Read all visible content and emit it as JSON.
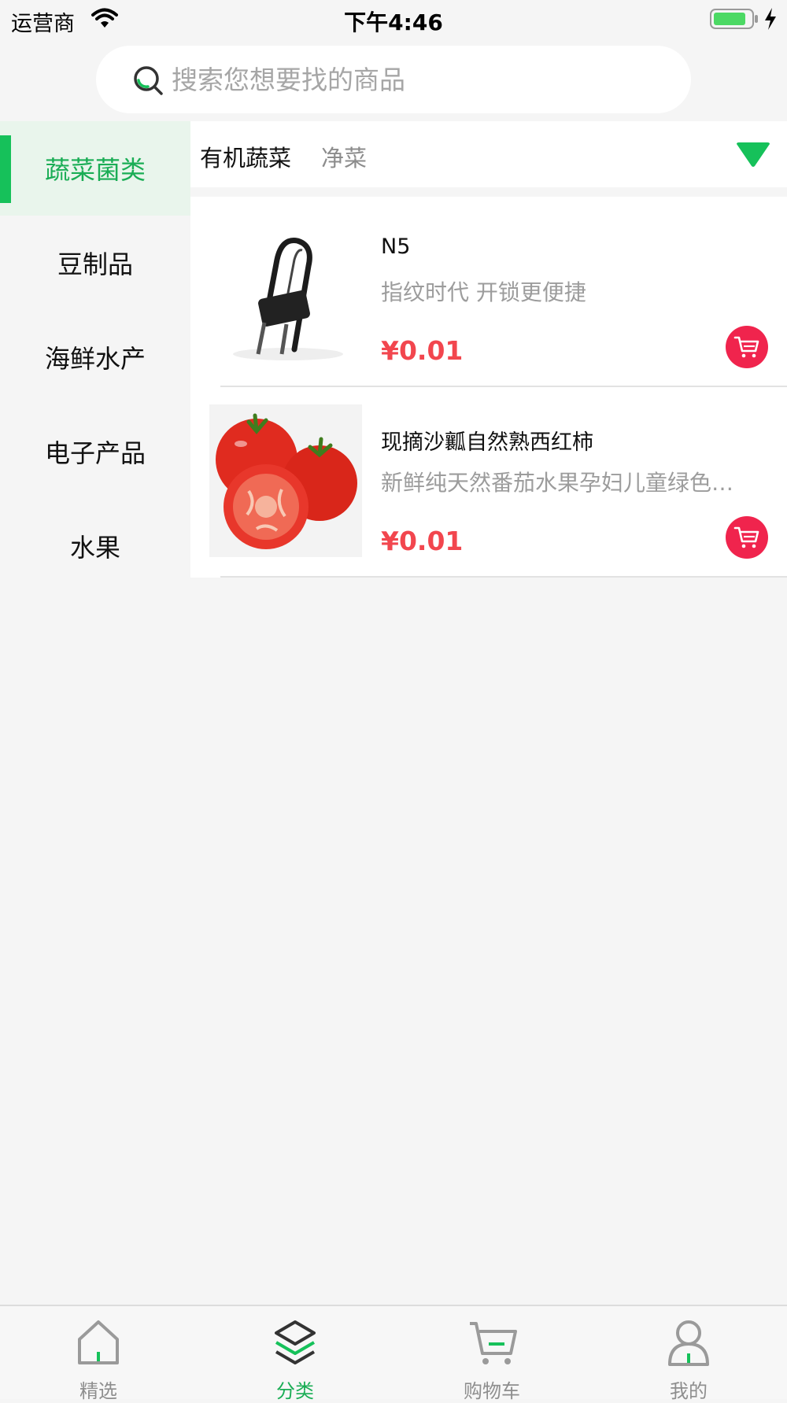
{
  "status_bar": {
    "carrier": "运营商",
    "time": "下午4:46"
  },
  "search": {
    "placeholder": "搜索您想要找的商品"
  },
  "sidebar": {
    "items": [
      {
        "label": "蔬菜菌类",
        "active": true
      },
      {
        "label": "豆制品",
        "active": false
      },
      {
        "label": "海鲜水产",
        "active": false
      },
      {
        "label": "电子产品",
        "active": false
      },
      {
        "label": "水果",
        "active": false
      }
    ]
  },
  "subtabs": {
    "items": [
      "有机蔬菜",
      "净菜"
    ],
    "active_index": 0
  },
  "products": [
    {
      "name": "N5",
      "desc": "指纹时代 开锁更便捷",
      "price": "¥0.01",
      "image": "u-lock-image"
    },
    {
      "name": "现摘沙瓤自然熟西红柿",
      "desc": "新鲜纯天然番茄水果孕妇儿童绿色蔬菜",
      "price": "¥0.01",
      "image": "tomato-image"
    }
  ],
  "tab_bar": {
    "items": [
      {
        "label": "精选",
        "icon": "home-icon"
      },
      {
        "label": "分类",
        "icon": "layers-icon"
      },
      {
        "label": "购物车",
        "icon": "cart-icon"
      },
      {
        "label": "我的",
        "icon": "user-icon"
      }
    ],
    "active_index": 1
  },
  "colors": {
    "accent": "#16c15a",
    "price": "#f2464e",
    "cart_button": "#f0244d"
  }
}
